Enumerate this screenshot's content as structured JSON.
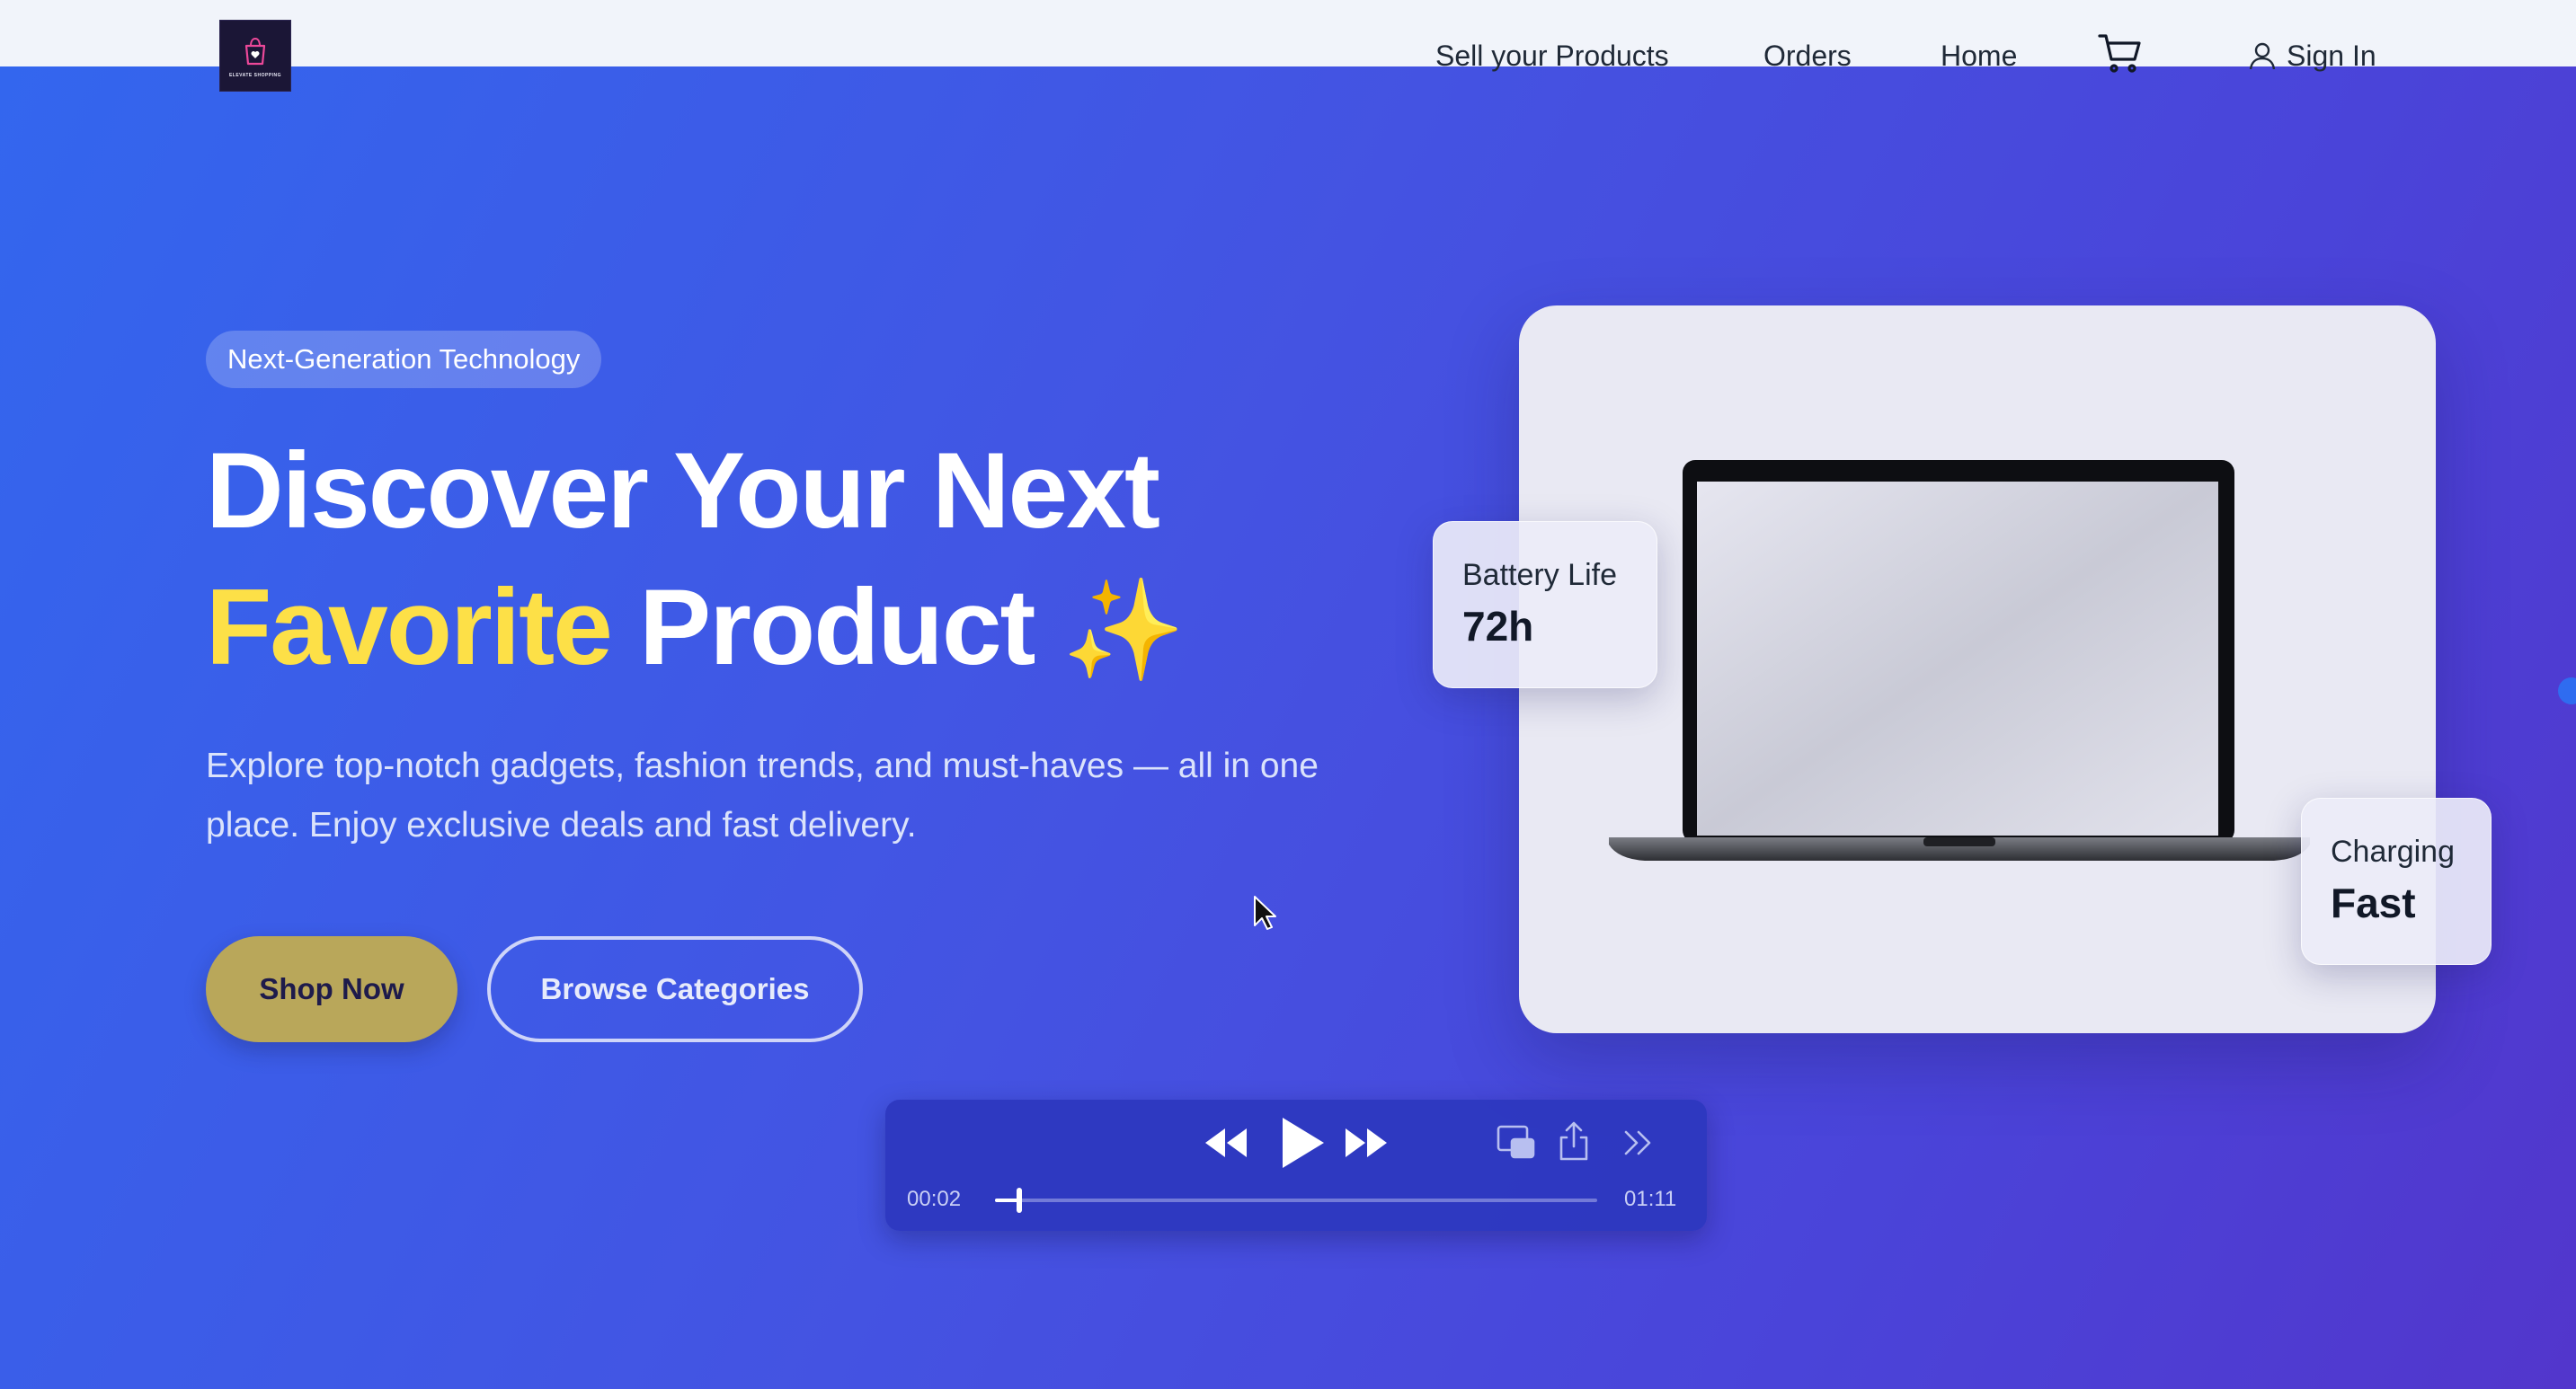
{
  "navbar": {
    "logo_icon": "shopping-bag-icon",
    "logo_text": "ELEVATE SHOPPING",
    "items": [
      {
        "label": "Sell your Products"
      },
      {
        "label": "Orders"
      },
      {
        "label": "Home"
      }
    ],
    "cart_icon": "cart-icon",
    "signin_label": "Sign In",
    "signin_icon": "user-icon"
  },
  "hero": {
    "badge": "Next-Generation Technology",
    "title_line1": "Discover Your Next",
    "title_accent": "Favorite",
    "title_rest": "Product",
    "title_sparkle": "✨",
    "description": "Explore top-notch gadgets, fashion trends, and must-haves — all in one place. Enjoy exclusive deals and fast delivery.",
    "primary_button": "Shop Now",
    "secondary_button": "Browse Categories"
  },
  "product_card": {
    "image": "laptop",
    "stats": [
      {
        "label": "Battery Life",
        "value": "72h"
      },
      {
        "label": "Charging",
        "value": "Fast"
      }
    ]
  },
  "media_player": {
    "current_time": "00:02",
    "duration": "01:11",
    "progress_fraction": 0.04,
    "controls": [
      "rewind-icon",
      "play-icon",
      "fast-forward-icon",
      "picture-in-picture-icon",
      "share-icon",
      "more-icon"
    ]
  },
  "colors": {
    "nav_bg": "#f1f4fa",
    "hero_gradient_start": "#3366ee",
    "hero_gradient_end": "#5236cc",
    "accent_yellow": "#fde047",
    "shop_button": "#b9a75a",
    "card_bg": "#e9e9f3"
  }
}
